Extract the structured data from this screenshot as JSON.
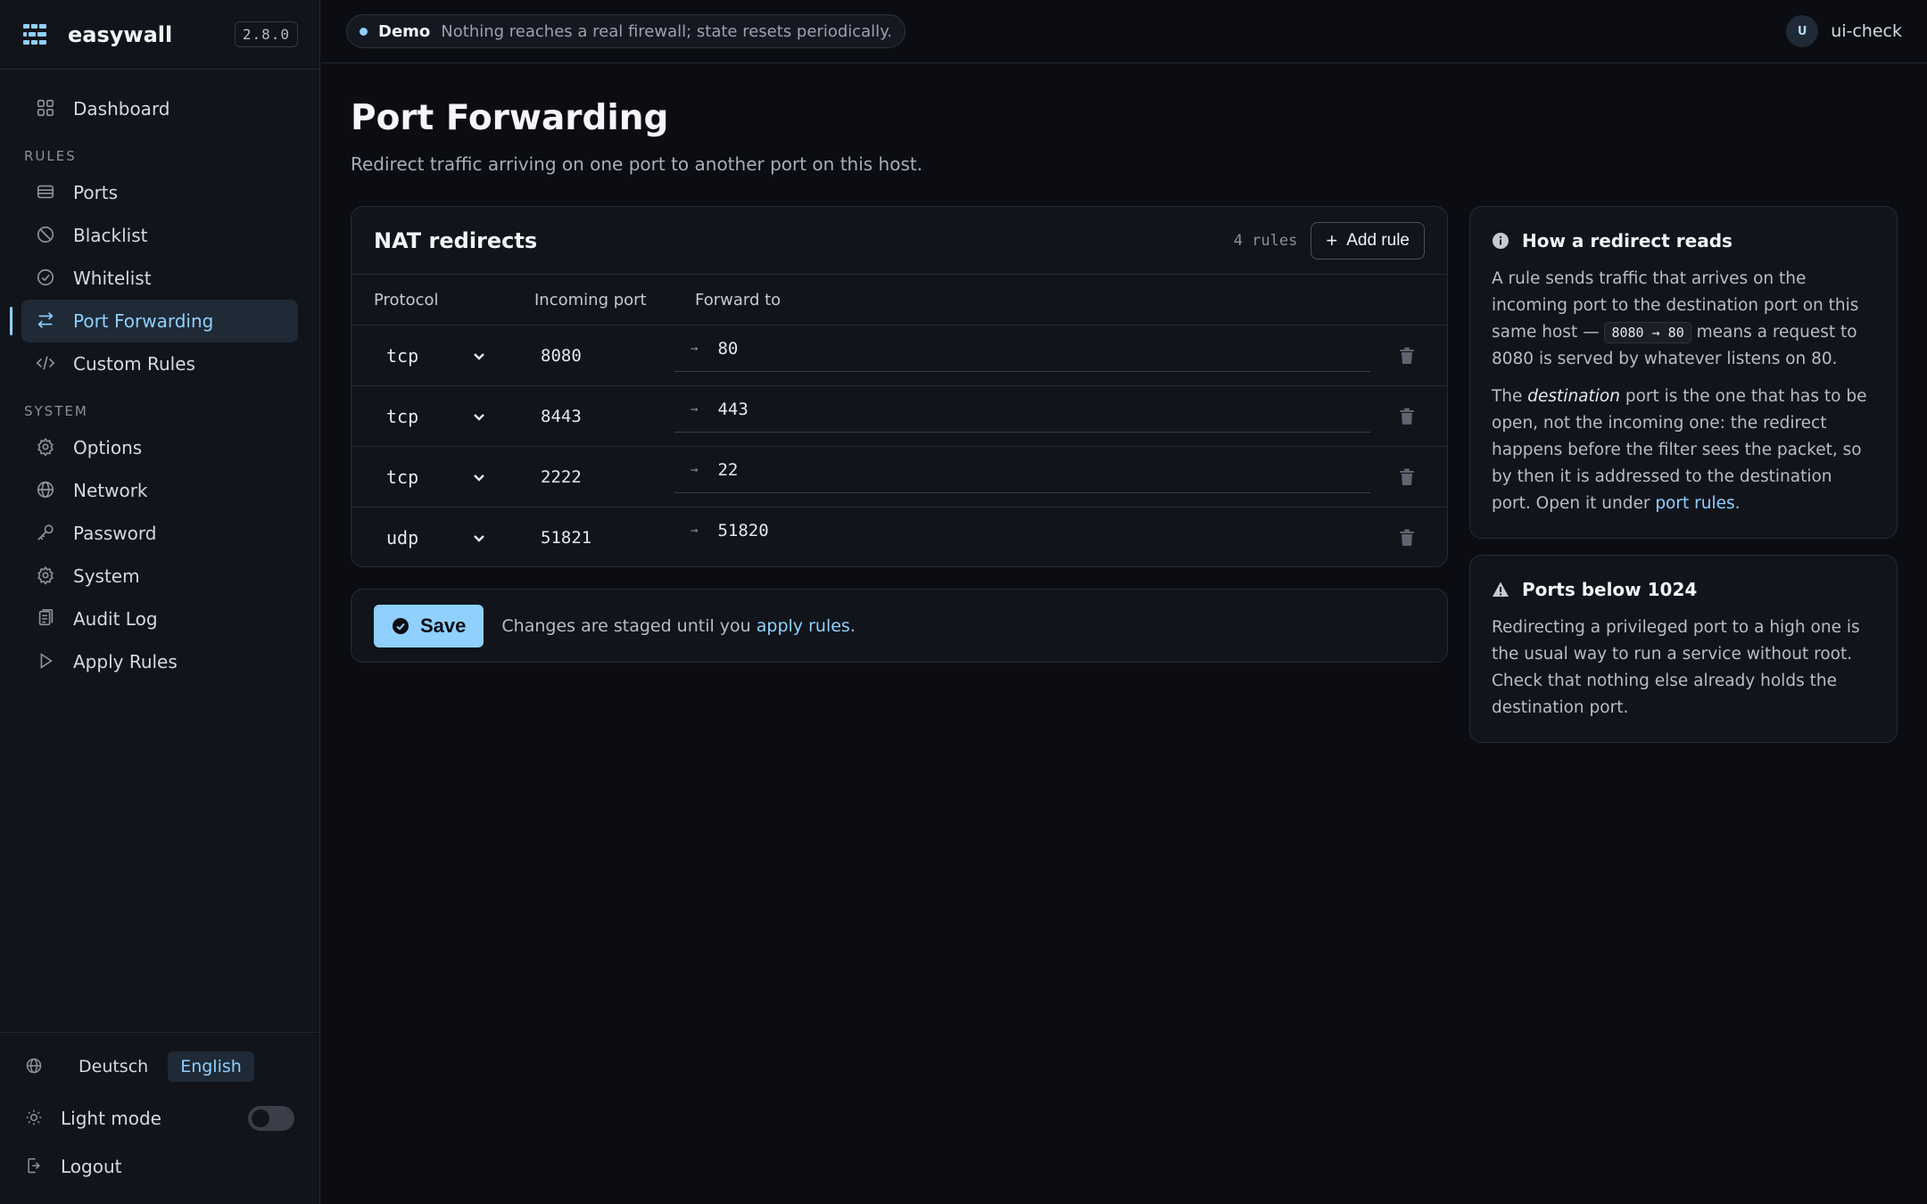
{
  "brand": {
    "name": "easywall",
    "version": "2.8.0"
  },
  "nav": {
    "dashboard": "Dashboard",
    "rules_label": "RULES",
    "rules": [
      {
        "label": "Ports",
        "icon": "ports-icon"
      },
      {
        "label": "Blacklist",
        "icon": "blacklist-icon"
      },
      {
        "label": "Whitelist",
        "icon": "whitelist-icon"
      },
      {
        "label": "Port Forwarding",
        "icon": "port-forwarding-icon",
        "active": true
      },
      {
        "label": "Custom Rules",
        "icon": "code-icon"
      }
    ],
    "system_label": "SYSTEM",
    "system": [
      {
        "label": "Options",
        "icon": "options-icon"
      },
      {
        "label": "Network",
        "icon": "network-icon"
      },
      {
        "label": "Password",
        "icon": "key-icon"
      },
      {
        "label": "System",
        "icon": "system-icon"
      },
      {
        "label": "Audit Log",
        "icon": "audit-log-icon"
      },
      {
        "label": "Apply Rules",
        "icon": "play-icon"
      }
    ]
  },
  "footer": {
    "lang_de": "Deutsch",
    "lang_en": "English",
    "selected_lang": "English",
    "light_mode": "Light mode",
    "light_mode_on": false,
    "logout": "Logout"
  },
  "topbar": {
    "demo_label": "Demo",
    "demo_text": "Nothing reaches a real firewall; state resets periodically.",
    "user_initial": "U",
    "user_name": "ui-check"
  },
  "page": {
    "title": "Port Forwarding",
    "subtitle": "Redirect traffic arriving on one port to another port on this host."
  },
  "nat": {
    "title": "NAT redirects",
    "count": "4 rules",
    "add_label": "Add rule",
    "columns": [
      "Protocol",
      "Incoming port",
      "Forward to"
    ],
    "arrow": "→",
    "rows": [
      {
        "protocol": "tcp",
        "incoming": "8080",
        "forward": "80"
      },
      {
        "protocol": "tcp",
        "incoming": "8443",
        "forward": "443"
      },
      {
        "protocol": "tcp",
        "incoming": "2222",
        "forward": "22"
      },
      {
        "protocol": "udp",
        "incoming": "51821",
        "forward": "51820"
      }
    ]
  },
  "savebar": {
    "save_label": "Save",
    "note_before": "Changes are staged until you ",
    "note_link": "apply rules",
    "note_after": "."
  },
  "info1": {
    "title": "How a redirect reads",
    "p1_a": "A rule sends traffic that arrives on the incoming port to the destination port on this same host — ",
    "p1_code": "8080 → 80",
    "p1_b": " means a request to 8080 is served by whatever listens on 80.",
    "p2_a": "The ",
    "p2_em": "destination",
    "p2_b": " port is the one that has to be open, not the incoming one: the redirect happens before the filter sees the packet, so by then it is addressed to the destination port. Open it under ",
    "p2_link": "port rules",
    "p2_c": "."
  },
  "info2": {
    "title": "Ports below 1024",
    "text": "Redirecting a privileged port to a high one is the usual way to run a service without root. Check that nothing else already holds the destination port."
  },
  "colors": {
    "accent": "#8fd0ff",
    "background": "#0b0d12",
    "panel": "#11141b"
  }
}
